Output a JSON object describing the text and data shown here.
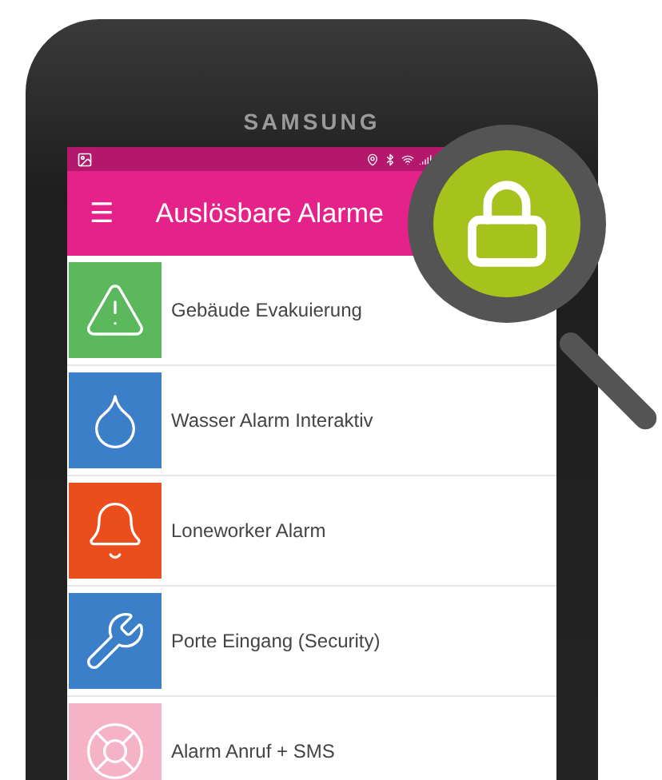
{
  "phone": {
    "brand": "SAMSUNG"
  },
  "app_bar": {
    "menu_icon": "☰",
    "title": "Auslösbare Alarme"
  },
  "alarms": [
    {
      "label": "Gebäude Evakuierung",
      "kind": "warning",
      "color": "#5cb85c"
    },
    {
      "label": "Wasser Alarm Interaktiv",
      "kind": "drop",
      "color": "#3b7fc9"
    },
    {
      "label": "Loneworker Alarm",
      "kind": "bell",
      "color": "#ea4e1c"
    },
    {
      "label": "Porte Eingang (Security)",
      "kind": "wrench",
      "color": "#3b7fc9"
    },
    {
      "label": "Alarm Anruf + SMS",
      "kind": "lifebuoy",
      "color": "#f4b3c6"
    }
  ]
}
